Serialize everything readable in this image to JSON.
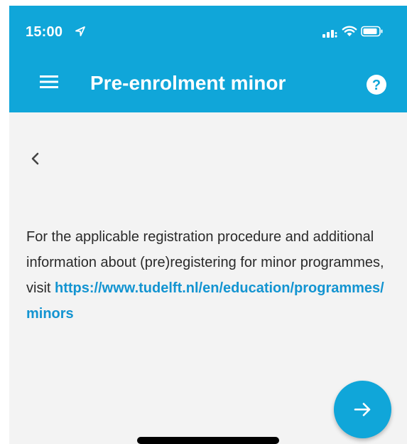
{
  "status_bar": {
    "time": "15:00",
    "icons": [
      "location-arrow-icon",
      "signal-icon",
      "wifi-icon",
      "battery-icon"
    ]
  },
  "header": {
    "title": "Pre-enrolment minor",
    "menu_icon": "hamburger-menu-icon",
    "help_icon": "help-icon"
  },
  "navigation": {
    "back_icon": "chevron-left-icon"
  },
  "content": {
    "paragraph": "For the applicable registration procedure and additional information about (pre)registering for minor programmes,",
    "visit_prefix": "visit ",
    "link": "https://www.tudelft.nl/en/education/programmes/minors"
  },
  "fab": {
    "icon": "arrow-right-icon"
  },
  "colors": {
    "primary": "#10a6d9",
    "link": "#1394d1",
    "background": "#f3f3f3",
    "text": "#2a2a2a"
  }
}
